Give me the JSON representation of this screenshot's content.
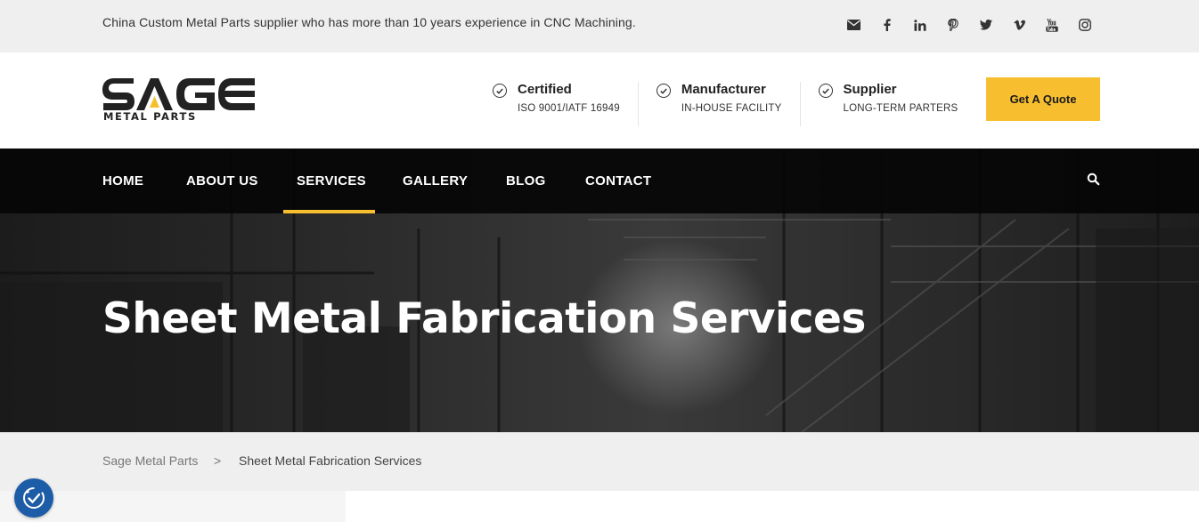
{
  "topbar": {
    "tagline": "China Custom Metal Parts supplier who has more than 10 years experience in CNC Machining.",
    "social_icons": [
      "envelope-icon",
      "facebook-icon",
      "linkedin-icon",
      "pinterest-icon",
      "twitter-icon",
      "vimeo-icon",
      "youtube-icon",
      "instagram-icon"
    ]
  },
  "header": {
    "logo_word": "SAGE",
    "logo_sub": "METAL PARTS",
    "features": [
      {
        "title": "Certified",
        "subtitle": "ISO 9001/IATF 16949"
      },
      {
        "title": "Manufacturer",
        "subtitle": "IN-HOUSE FACILITY"
      },
      {
        "title": "Supplier",
        "subtitle": "LONG-TERM PARTERS"
      }
    ],
    "quote_button": "Get A Quote"
  },
  "nav": {
    "items": [
      "HOME",
      "ABOUT US",
      "SERVICES",
      "GALLERY",
      "BLOG",
      "CONTACT"
    ],
    "active": "SERVICES"
  },
  "hero": {
    "title": "Sheet Metal Fabrication Services"
  },
  "breadcrumb": {
    "home": "Sage Metal Parts",
    "separator": ">",
    "current": "Sheet Metal Fabrication Services"
  },
  "colors": {
    "accent": "#f7bf30",
    "nav_bg": "#0a0a0a",
    "accessibility": "#1d5ca6"
  }
}
